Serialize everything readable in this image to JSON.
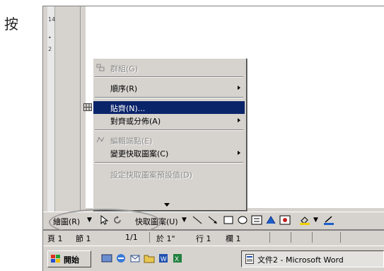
{
  "side_text": "按",
  "ruler": {
    "ticks": [
      "14",
      "•",
      "2"
    ]
  },
  "menu": {
    "items": [
      {
        "label": "群組(G)",
        "disabled": true,
        "submenu": false,
        "icon": "group-icon"
      },
      {
        "label": "順序(R)",
        "disabled": false,
        "submenu": true,
        "icon": ""
      },
      {
        "label": "貼齊(N)...",
        "disabled": false,
        "submenu": false,
        "icon": "grid-icon",
        "selected": true
      },
      {
        "label": "對齊或分佈(A)",
        "disabled": false,
        "submenu": true,
        "icon": ""
      },
      {
        "label": "編輯端點(E)",
        "disabled": true,
        "submenu": false,
        "icon": "edit-points-icon"
      },
      {
        "label": "變更快取圖案(C)",
        "disabled": false,
        "submenu": true,
        "icon": ""
      },
      {
        "label": "設定快取圖案預設值(D)",
        "disabled": true,
        "submenu": false,
        "icon": ""
      }
    ]
  },
  "drawbar": {
    "draw_label": "繪圖(R)",
    "autoshapes_label": "快取圖案(U)"
  },
  "statusbar": {
    "page": "頁 1",
    "section": "節 1",
    "pages": "1/1",
    "at": "於 1\"",
    "line": "行 1",
    "col": "欄 1"
  },
  "taskbar": {
    "start_label": "開始",
    "task_label": "文件2 - Microsoft Word"
  },
  "colors": {
    "menu_highlight": "#0a246a",
    "face": "#d6d3ce",
    "callout_ellipse": "#9a9a9a"
  }
}
